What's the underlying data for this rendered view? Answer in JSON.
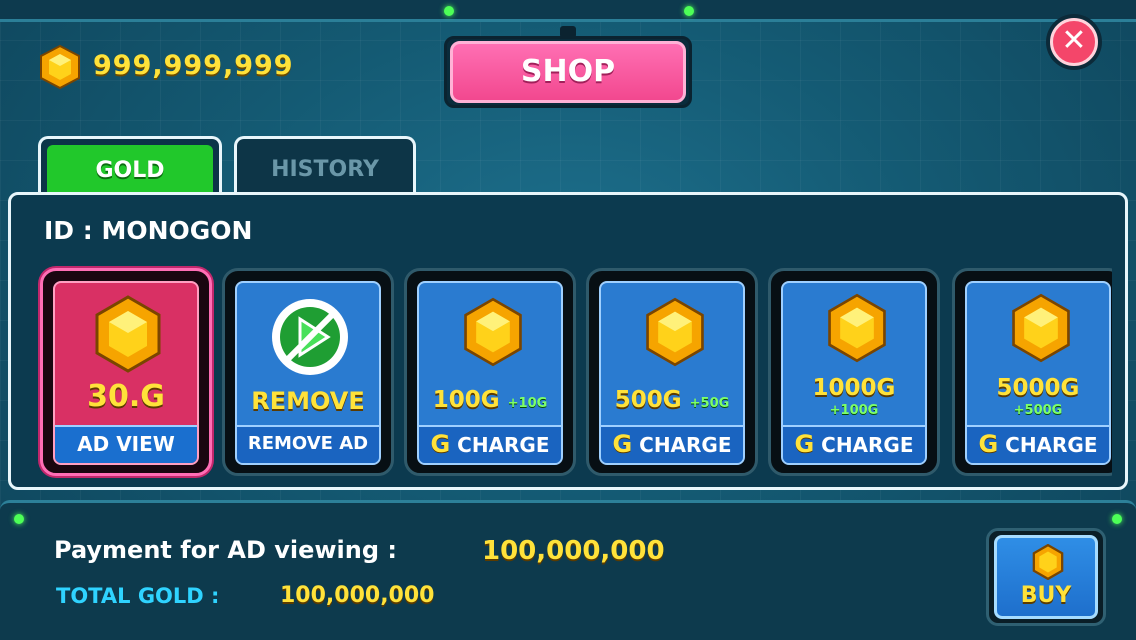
{
  "header": {
    "gold_amount": "999,999,999",
    "title": "SHOP",
    "close_glyph": "✕"
  },
  "tabs": [
    {
      "label": "GOLD",
      "active": true
    },
    {
      "label": "HISTORY",
      "active": false
    }
  ],
  "account": {
    "id_label": "ID : MONOGON"
  },
  "cards": [
    {
      "amount": "30.G",
      "bonus": "",
      "action": "AD VIEW",
      "icon": "gold-gem-icon",
      "selected": true
    },
    {
      "amount": "REMOVE",
      "bonus": "",
      "action": "REMOVE AD",
      "icon": "no-ad-play-icon",
      "selected": false
    },
    {
      "amount": "100G",
      "bonus": "+10G",
      "action": "CHARGE",
      "icon": "gold-gem-icon",
      "selected": false
    },
    {
      "amount": "500G",
      "bonus": "+50G",
      "action": "CHARGE",
      "icon": "gold-gem-icon",
      "selected": false
    },
    {
      "amount": "1000G",
      "bonus": "+100G",
      "action": "CHARGE",
      "icon": "gold-gem-icon",
      "selected": false
    },
    {
      "amount": "5000G",
      "bonus": "+500G",
      "action": "CHARGE",
      "icon": "gold-gem-icon",
      "selected": false
    }
  ],
  "charge_prefix": "G",
  "summary": {
    "payment_label": "Payment for AD viewing :",
    "payment_value": "100,000,000",
    "total_label": "TOTAL GOLD :",
    "total_value": "100,000,000"
  },
  "buy_button": {
    "label": "BUY"
  },
  "colors": {
    "gold": "#ffe23a",
    "tab_active": "#21c82b",
    "shop_pink": "#f2488f",
    "card_blue": "#2a7bd0",
    "card_red": "#d93064",
    "close_red": "#f4466a",
    "total_cyan": "#2fd3ff"
  }
}
